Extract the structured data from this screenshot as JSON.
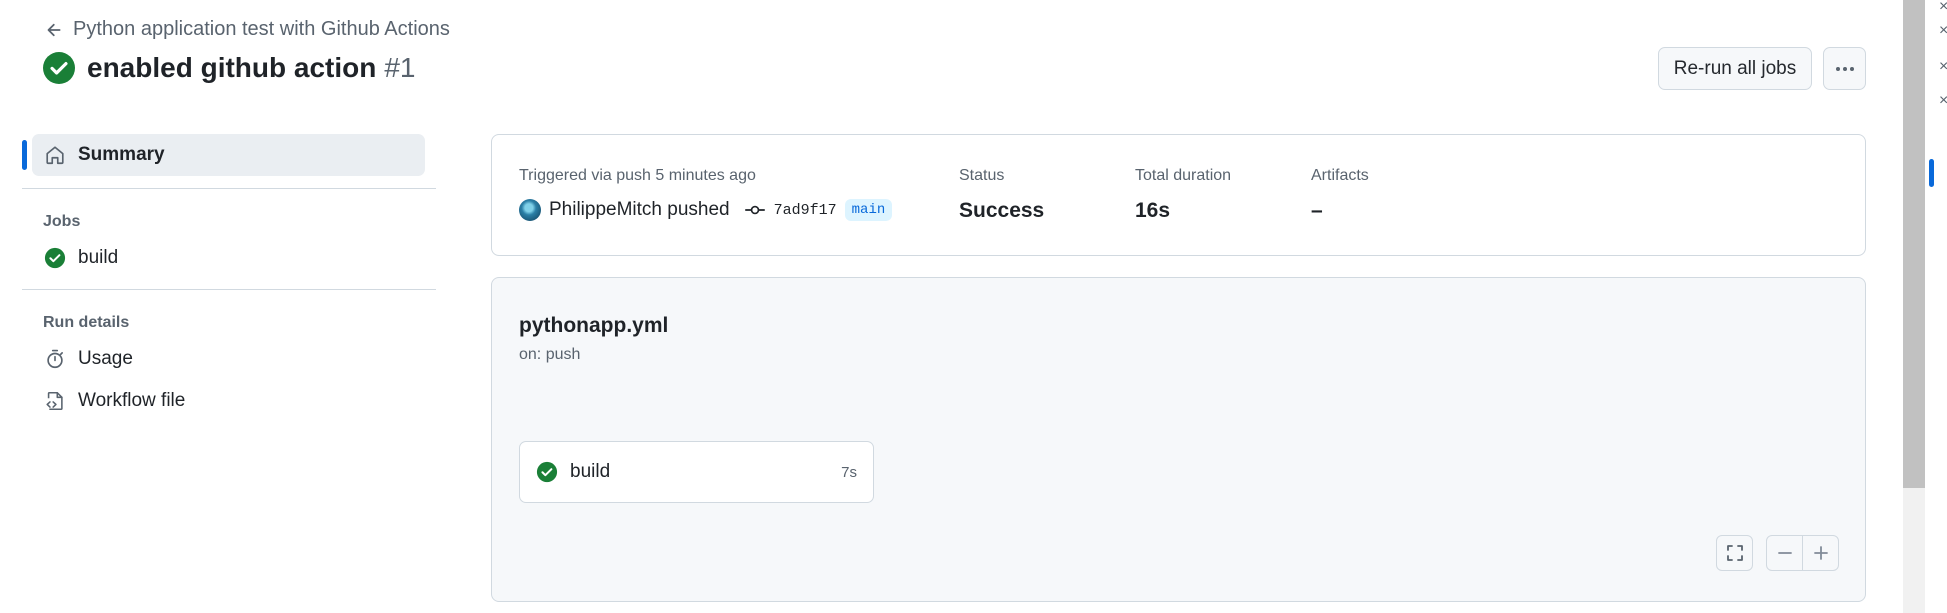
{
  "header": {
    "back_label": "Python application test with Github Actions",
    "run_title": "enabled github action",
    "run_number": "#1",
    "rerun_label": "Re-run all jobs",
    "more_label": "···"
  },
  "sidebar": {
    "summary_label": "Summary",
    "jobs_heading": "Jobs",
    "jobs": [
      {
        "label": "build",
        "status": "success"
      }
    ],
    "run_details_heading": "Run details",
    "usage_label": "Usage",
    "workflow_file_label": "Workflow file"
  },
  "summary": {
    "triggered_text": "Triggered via push 5 minutes ago",
    "actor_text": "PhilippeMitch pushed",
    "commit_sha": "7ad9f17",
    "branch": "main",
    "status_label": "Status",
    "status_value": "Success",
    "duration_label": "Total duration",
    "duration_value": "16s",
    "artifacts_label": "Artifacts",
    "artifacts_value": "–"
  },
  "workflow": {
    "file_name": "pythonapp.yml",
    "trigger": "on: push",
    "job_name": "build",
    "job_duration": "7s"
  },
  "colors": {
    "success_green": "#1a7f37",
    "accent_blue": "#0969da",
    "border": "#d1d9e0"
  },
  "icons": [
    "arrow-left-icon",
    "check-circle-icon",
    "kebab-horizontal-icon",
    "home-icon",
    "stopwatch-icon",
    "file-code-icon",
    "git-commit-icon",
    "fullscreen-icon",
    "minus-icon",
    "plus-icon"
  ]
}
